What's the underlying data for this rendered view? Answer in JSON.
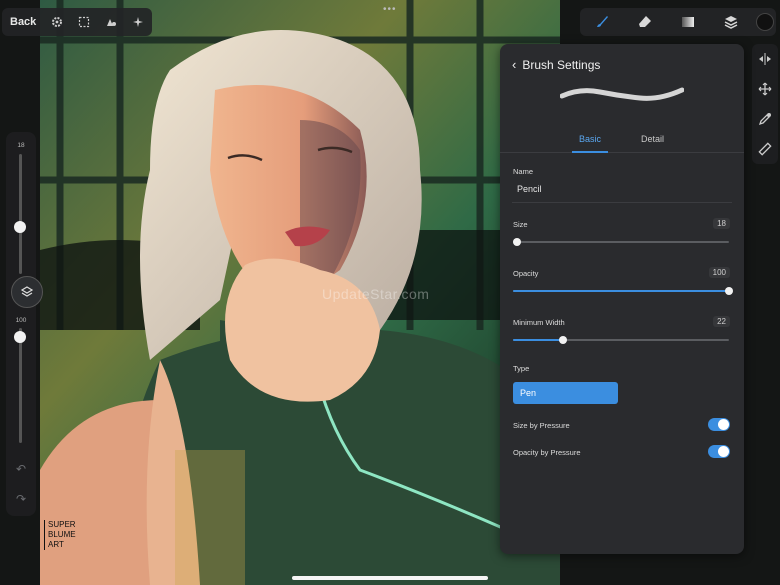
{
  "top_left_toolbar": {
    "back_label": "Back",
    "icons": [
      "gear-icon",
      "selection-icon",
      "shapes-icon",
      "sparkle-icon"
    ]
  },
  "top_right_toolbar": {
    "icons": [
      "brush-icon",
      "eraser-icon",
      "gradient-icon",
      "layers-icon"
    ],
    "current_color": "#111111"
  },
  "left_sidebar": {
    "size_value": "18",
    "opacity_value": "100",
    "size_level": 0.61,
    "opacity_level": 0.08
  },
  "right_tools": {
    "icons": [
      "flip-icon",
      "move-icon",
      "eyedropper-icon",
      "ruler-icon"
    ]
  },
  "brush_settings": {
    "title": "Brush Settings",
    "tabs": [
      "Basic",
      "Detail"
    ],
    "active_tab": "Basic",
    "name_label": "Name",
    "name_value": "Pencil",
    "size_label": "Size",
    "size_value": "18",
    "size_fraction": 0.02,
    "opacity_label": "Opacity",
    "opacity_value": "100",
    "opacity_fraction": 1.0,
    "min_width_label": "Minimum Width",
    "min_width_value": "22",
    "min_width_fraction": 0.23,
    "type_label": "Type",
    "type_value": "Pen",
    "size_by_pressure_label": "Size by Pressure",
    "size_by_pressure_on": true,
    "opacity_by_pressure_label": "Opacity by Pressure",
    "opacity_by_pressure_on": true
  },
  "canvas": {
    "watermark": "UpdateStar.com",
    "signature": [
      "SUPER",
      "BLUME",
      "ART"
    ]
  },
  "colors": {
    "accent": "#3b8ee0",
    "panel": "#2a2b2e"
  }
}
